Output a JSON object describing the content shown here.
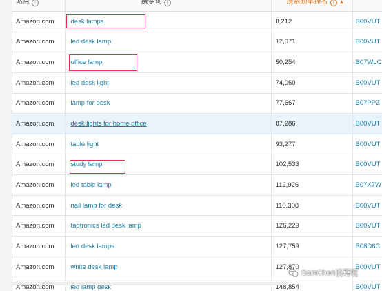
{
  "table": {
    "headers": {
      "market": "站点",
      "search_term": "搜索词",
      "search_rank": "搜索频率排名",
      "asin": ""
    },
    "sort_indicator": "▲",
    "rows": [
      {
        "market": "Amazon.com",
        "term": "desk lamps",
        "rank": "8,212",
        "asin": "B00VUT"
      },
      {
        "market": "Amazon.com",
        "term": "led desk lamp",
        "rank": "12,071",
        "asin": "B00VUT"
      },
      {
        "market": "Amazon.com",
        "term": "office lamp",
        "rank": "50,254",
        "asin": "B07WLC"
      },
      {
        "market": "Amazon.com",
        "term": "led desk light",
        "rank": "74,060",
        "asin": "B00VUT"
      },
      {
        "market": "Amazon.com",
        "term": "lamp for desk",
        "rank": "77,667",
        "asin": "B07PPZ"
      },
      {
        "market": "Amazon.com",
        "term": "desk lights for home office",
        "rank": "87,286",
        "asin": "B00VUT"
      },
      {
        "market": "Amazon.com",
        "term": "table light",
        "rank": "93,277",
        "asin": "B00VUT"
      },
      {
        "market": "Amazon.com",
        "term": "study lamp",
        "rank": "102,533",
        "asin": "B00VUT"
      },
      {
        "market": "Amazon.com",
        "term": "led table lamp",
        "rank": "112,926",
        "asin": "B07X7W"
      },
      {
        "market": "Amazon.com",
        "term": "nail lamp for desk",
        "rank": "118,308",
        "asin": "B00VUT"
      },
      {
        "market": "Amazon.com",
        "term": "taotronics led desk lamp",
        "rank": "126,229",
        "asin": "B00VUT"
      },
      {
        "market": "Amazon.com",
        "term": "led desk lamps",
        "rank": "127,759",
        "asin": "B08D6C"
      },
      {
        "market": "Amazon.com",
        "term": "white desk lamp",
        "rank": "127,870",
        "asin": "B00VUT"
      },
      {
        "market": "Amazon.com",
        "term": "led lamp desk",
        "rank": "148,854",
        "asin": "B00VUT"
      }
    ]
  },
  "watermark": {
    "text": "SamChen谈跨境"
  },
  "colors": {
    "link": "#1a7ea8",
    "sort_header": "#e8751a",
    "highlight_row": "#e9f3fb",
    "annotation_box": "#e3304a"
  }
}
